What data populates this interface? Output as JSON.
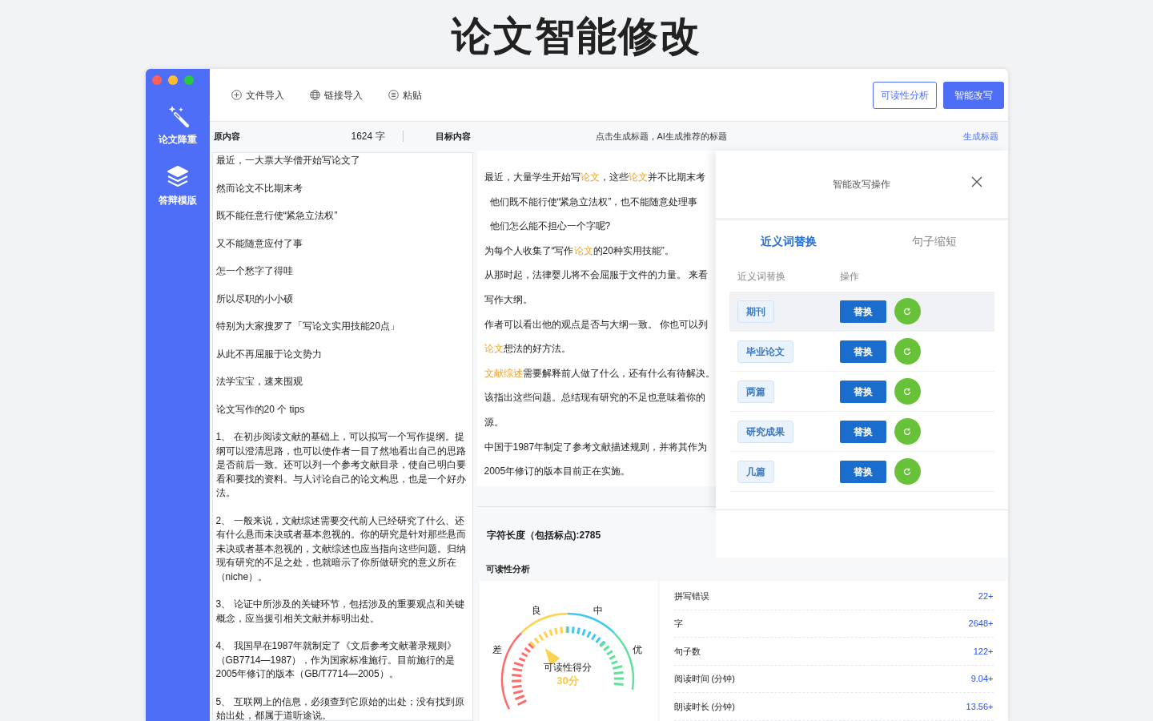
{
  "page_title": "论文智能修改",
  "sidebar": {
    "items": [
      {
        "label": "论文降重"
      },
      {
        "label": "答辩模版"
      }
    ]
  },
  "toolbar": {
    "items": [
      {
        "label": "文件导入"
      },
      {
        "label": "链接导入"
      },
      {
        "label": "粘贴"
      }
    ],
    "buttons": [
      {
        "label": "可读性分析",
        "kind": "outline"
      },
      {
        "label": "智能改写",
        "kind": "primary"
      }
    ]
  },
  "source": {
    "title": "原内容",
    "count": "1624 字",
    "paragraphs": [
      "最近，一大票大学僧开始写论文了",
      "然而论文不比期末考",
      "既不能任意行使“紧急立法权”",
      "又不能随意应付了事",
      "怎一个愁字了得哇",
      "所以尽职的小小硕",
      "特别为大家搜罗了「写论文实用技能20点」",
      "从此不再屈服于论文势力",
      "法学宝宝，速来围观",
      "论文写作的20 个 tips",
      "1、 在初步阅读文献的基础上，可以拟写一个写作提纲。提纲可以澄清思路，也可以使作者一目了然地看出自己的思路是否前后一致。还可以列一个参考文献目录，使自己明白要看和要找的资料。与人讨论自己的论文构思，也是一个好办法。",
      "2、 一般来说，文献综述需要交代前人已经研究了什么、还有什么悬而未决或者基本忽视的。你的研究是针对那些悬而未决或者基本忽视的，文献综述也应当指向这些问题。归纳现有研究的不足之处，也就暗示了你所做研究的意义所在（niche）。",
      "3、 论证中所涉及的关键环节，包括涉及的重要观点和关键概念，应当援引相关文献并标明出处。",
      "4、 我国早在1987年就制定了《文后参考文献著录规则》（GB7714—1987），作为国家标准施行。目前施行的是2005年修订的版本（GB/T7714—2005）。",
      "5、 互联网上的信息，必须查到它原始的出处；没有找到原始出处，都属于道听途说。"
    ]
  },
  "target": {
    "title": "目标内容",
    "hint": "点击生成标题，AI生成推荐的标题",
    "link": "生成标题",
    "lines": [
      {
        "indent": false,
        "segments": [
          {
            "text": "最近，大量学生开始写",
            "highlight": false
          },
          {
            "text": "论文",
            "highlight": true
          },
          {
            "text": "，这些",
            "highlight": false
          },
          {
            "text": "论文",
            "highlight": true
          },
          {
            "text": "并不比期末考",
            "highlight": false
          }
        ]
      },
      {
        "indent": true,
        "segments": [
          {
            "text": "他们既不能行使“紧急立法权”，也不能随意处理事",
            "highlight": false
          }
        ]
      },
      {
        "indent": true,
        "segments": [
          {
            "text": "他们怎么能不担心一个字呢?",
            "highlight": false
          }
        ]
      },
      {
        "indent": false,
        "segments": [
          {
            "text": "为每个人收集了“写作",
            "highlight": false
          },
          {
            "text": "论文",
            "highlight": true
          },
          {
            "text": "的20种实用技能”。",
            "highlight": false
          }
        ]
      },
      {
        "indent": false,
        "segments": [
          {
            "text": "从那时起，法律婴儿将不会屈服于文件的力量。 来看",
            "highlight": false
          }
        ]
      },
      {
        "indent": false,
        "segments": [
          {
            "text": "写作大纲。",
            "highlight": false
          }
        ]
      },
      {
        "indent": false,
        "segments": [
          {
            "text": "作者可以看出他的观点是否与大纲一致。 你也可以列",
            "highlight": false
          }
        ]
      },
      {
        "indent": false,
        "segments": [
          {
            "text": "论文",
            "highlight": true
          },
          {
            "text": "想法的好方法。",
            "highlight": false
          }
        ]
      },
      {
        "indent": false,
        "segments": [
          {
            "text": "文献综述",
            "highlight": true
          },
          {
            "text": "需要解释前人做了什么，还有什么有待解决。",
            "highlight": false
          }
        ]
      },
      {
        "indent": false,
        "segments": [
          {
            "text": "该指出这些问题。总结现有研究的不足也意味着你的",
            "highlight": false
          }
        ]
      },
      {
        "indent": false,
        "segments": [
          {
            "text": "源。",
            "highlight": false
          }
        ]
      },
      {
        "indent": false,
        "segments": [
          {
            "text": "中国于1987年制定了参考文献描述规则，并将其作为",
            "highlight": false
          }
        ]
      },
      {
        "indent": false,
        "segments": [
          {
            "text": "2005年修订的版本目前正在实施。",
            "highlight": false
          }
        ]
      }
    ],
    "char_length": "字符长度（包括标点):2785"
  },
  "rewrite_panel": {
    "title": "智能改写操作",
    "tabs": [
      {
        "label": "近义词替换",
        "selected": true
      },
      {
        "label": "句子缩短",
        "selected": false
      }
    ],
    "columns": [
      "近义词替换",
      "操作"
    ],
    "rows": [
      {
        "word": "期刊",
        "action": "替换",
        "selected": true
      },
      {
        "word": "毕业论文",
        "action": "替换",
        "selected": false
      },
      {
        "word": "两篇",
        "action": "替换",
        "selected": false
      },
      {
        "word": "研究成果",
        "action": "替换",
        "selected": false
      },
      {
        "word": "几篇",
        "action": "替换",
        "selected": false
      }
    ]
  },
  "readability": {
    "title": "可读性分析",
    "gauge": {
      "labels": [
        "差",
        "良",
        "中",
        "优"
      ],
      "caption": "可读性得分",
      "score": "30分"
    },
    "stats": [
      {
        "label": "拼写错误",
        "value": "22+"
      },
      {
        "label": "字",
        "value": "2648+"
      },
      {
        "label": "句子数",
        "value": "122+"
      },
      {
        "label": "阅读时间 (分钟)",
        "value": "9.04+"
      },
      {
        "label": "朗读时长 (分钟)",
        "value": "13.56+"
      }
    ]
  }
}
